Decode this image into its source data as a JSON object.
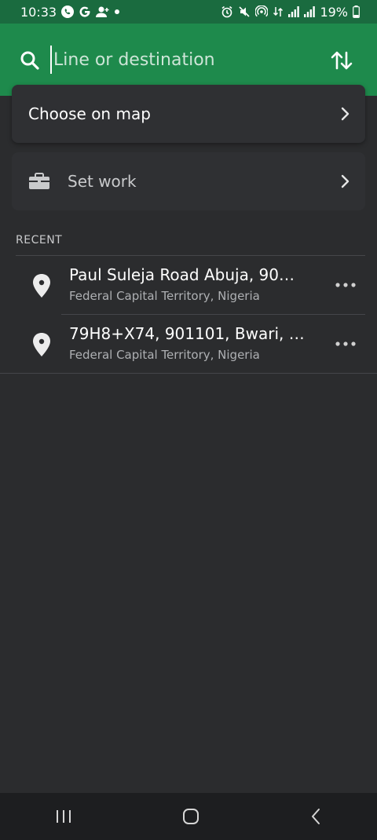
{
  "status_bar": {
    "time": "10:33",
    "battery": "19%"
  },
  "header": {
    "search_placeholder": "Line or destination"
  },
  "options": {
    "choose_on_map": "Choose on map",
    "set_work": "Set work"
  },
  "recent": {
    "title": "RECENT",
    "items": [
      {
        "title": "Paul Suleja Road Abuja, 90…",
        "subtitle": "Federal Capital Territory, Nigeria"
      },
      {
        "title": "79H8+X74, 901101, Bwari, F…",
        "subtitle": "Federal Capital Territory, Nigeria"
      }
    ]
  },
  "colors": {
    "header_green": "#1e8a4c",
    "status_green": "#1a6b3f",
    "background": "#2b2c2e"
  }
}
